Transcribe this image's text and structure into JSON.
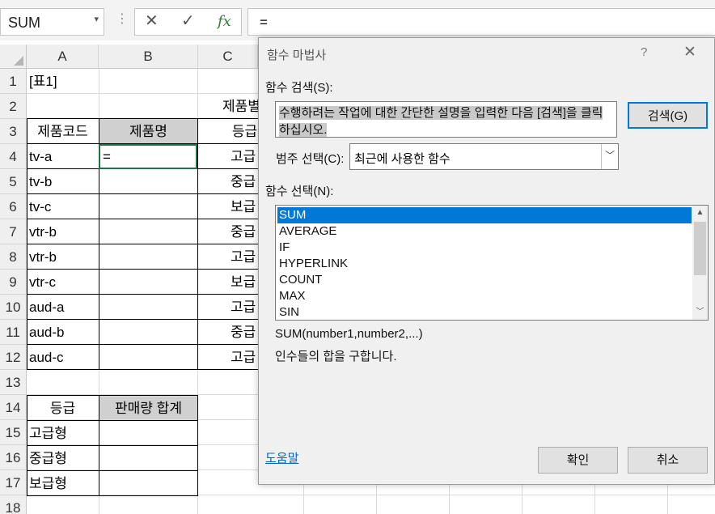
{
  "formula_bar": {
    "name_box": "SUM",
    "name_box_arrow": "▾",
    "cancel_icon": "✕",
    "enter_icon": "✓",
    "fx_icon": "fx",
    "formula": "="
  },
  "columns": [
    "A",
    "B",
    "C"
  ],
  "rows": [
    "1",
    "2",
    "3",
    "4",
    "5",
    "6",
    "7",
    "8",
    "9",
    "10",
    "11",
    "12",
    "13",
    "14",
    "15",
    "16",
    "17",
    "18"
  ],
  "sheet": {
    "a1": "[표1]",
    "title_partial": "제품별",
    "headers": {
      "code": "제품코드",
      "name": "제품명",
      "grade": "등급"
    },
    "products": [
      {
        "code": "tv-a",
        "grade": "고급"
      },
      {
        "code": "tv-b",
        "grade": "중급"
      },
      {
        "code": "tv-c",
        "grade": "보급"
      },
      {
        "code": "vtr-b",
        "grade": "중급"
      },
      {
        "code": "vtr-b",
        "grade": "고급"
      },
      {
        "code": "vtr-c",
        "grade": "보급"
      },
      {
        "code": "aud-a",
        "grade": "고급"
      },
      {
        "code": "aud-b",
        "grade": "중급"
      },
      {
        "code": "aud-c",
        "grade": "고급"
      }
    ],
    "active_cell_value": "=",
    "summary_headers": {
      "grade": "등급",
      "total": "판매량 합계"
    },
    "summary_rows": [
      "고급형",
      "중급형",
      "보급형"
    ]
  },
  "dialog": {
    "title": "함수 마법사",
    "help_icon": "?",
    "close_icon": "✕",
    "search_label": "함수 검색(S):",
    "search_text": "수행하려는 작업에 대한 간단한 설명을 입력한 다음 [검색]을 클릭하십시오.",
    "search_button": "검색(G)",
    "category_label": "범주 선택(C):",
    "category_value": "최근에 사용한 함수",
    "function_label": "함수 선택(N):",
    "functions": [
      "SUM",
      "AVERAGE",
      "IF",
      "HYPERLINK",
      "COUNT",
      "MAX",
      "SIN"
    ],
    "selected_function": "SUM",
    "signature": "SUM(number1,number2,...)",
    "description": "인수들의 합을 구합니다.",
    "help_link": "도움말",
    "ok_button": "확인",
    "cancel_button": "취소",
    "accent_color": "#0078d7"
  }
}
